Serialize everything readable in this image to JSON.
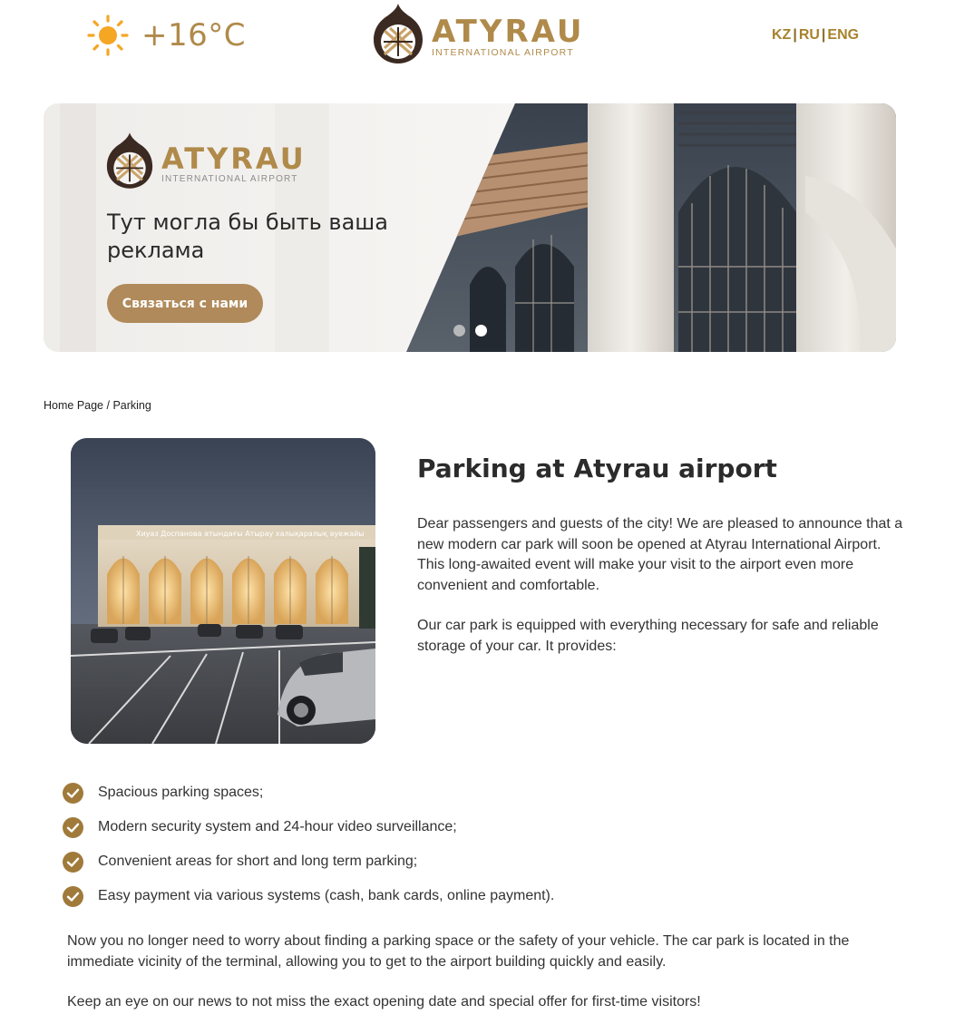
{
  "header": {
    "temperature": "+16°C",
    "logo_name": "ATYRAU",
    "logo_subtitle": "INTERNATIONAL AIRPORT",
    "languages": [
      "KZ",
      "RU",
      "ENG"
    ]
  },
  "banner": {
    "logo_name": "ATYRAU",
    "logo_subtitle": "INTERNATIONAL AIRPORT",
    "title": "Тут могла бы быть ваша реклама",
    "button_label": "Связаться с нами",
    "building_sign": "Хиуаз Доспанова атындағы Атырау халықаралық әуежайы"
  },
  "breadcrumb": {
    "home": "Home Page",
    "separator": " / ",
    "current": "Parking"
  },
  "article": {
    "title": "Parking at Atyrau airport",
    "paragraph1": "Dear passengers and guests of the city! We are pleased to announce that a new modern car park will soon be opened at Atyrau International Airport. This long-awaited event will make your visit to the airport even more convenient and comfortable.",
    "paragraph2": "Our car park is equipped with everything necessary for safe and reliable storage of your car. It provides:",
    "features": [
      "Spacious parking spaces;",
      "Modern security system and 24-hour video surveillance;",
      "Convenient areas for short and long term parking;",
      "Easy payment via various systems (cash, bank cards, online payment)."
    ],
    "paragraph3": "Now you no longer need to worry about finding a parking space or the safety of your vehicle. The car park is located in the immediate vicinity of the terminal, allowing you to get to the airport building quickly and easily.",
    "paragraph4": "Keep an eye on our news to not miss the exact opening date and special offer for first-time visitors!"
  },
  "colors": {
    "brand_gold": "#b08a4a",
    "button": "#b08a5a",
    "sun": "#f5a623"
  },
  "icons": {
    "weather": "sun-icon",
    "feature": "check-circle-icon",
    "logo": "airport-dome-logo-icon"
  }
}
